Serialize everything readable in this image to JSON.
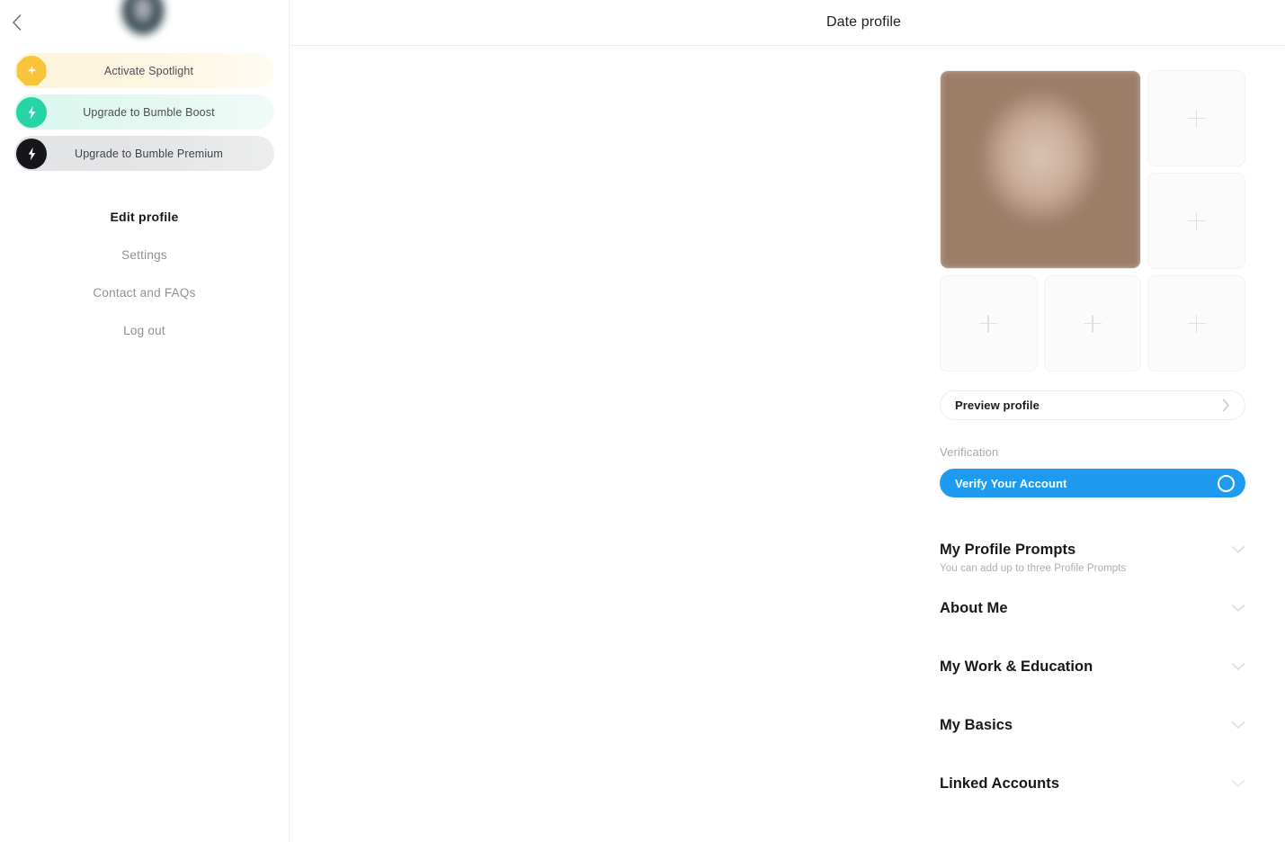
{
  "sidebar": {
    "back_icon": "chevron-left-icon",
    "avatar_alt": "user-avatar",
    "promos": [
      {
        "label": "Activate Spotlight",
        "icon": "spotlight-icon",
        "accent": "#f8c43c",
        "bg": "#fdf4da"
      },
      {
        "label": "Upgrade to Bumble Boost",
        "icon": "bolt-icon",
        "accent": "#25d5a5",
        "bg": "#d9f7ee"
      },
      {
        "label": "Upgrade to Bumble Premium",
        "icon": "bolt-icon",
        "accent": "#14161a",
        "bg": "#e2e3e5"
      }
    ],
    "nav": [
      {
        "label": "Edit profile",
        "active": true
      },
      {
        "label": "Settings",
        "active": false
      },
      {
        "label": "Contact and FAQs",
        "active": false
      },
      {
        "label": "Log out",
        "active": false
      }
    ]
  },
  "header": {
    "title": "Date profile"
  },
  "photos": {
    "cells": [
      {
        "type": "photo",
        "filled": true
      },
      {
        "type": "add",
        "filled": false
      },
      {
        "type": "add",
        "filled": false
      },
      {
        "type": "add",
        "filled": false
      },
      {
        "type": "add",
        "filled": false
      },
      {
        "type": "add",
        "filled": false
      }
    ],
    "add_icon": "plus-icon"
  },
  "preview": {
    "label": "Preview profile",
    "icon": "chevron-right-icon"
  },
  "verification": {
    "section_label": "Verification",
    "button_label": "Verify Your Account",
    "button_color": "#1e9bf0",
    "badge_icon": "circle-outline-icon"
  },
  "sections": [
    {
      "title": "My Profile Prompts",
      "subtitle": "You can add up to three Profile Prompts",
      "icon": "chevron-down-icon"
    },
    {
      "title": "About Me",
      "subtitle": "",
      "icon": "chevron-down-icon"
    },
    {
      "title": "My Work & Education",
      "subtitle": "",
      "icon": "chevron-down-icon"
    },
    {
      "title": "My Basics",
      "subtitle": "",
      "icon": "chevron-down-icon"
    },
    {
      "title": "Linked Accounts",
      "subtitle": "",
      "icon": "chevron-down-icon"
    }
  ]
}
